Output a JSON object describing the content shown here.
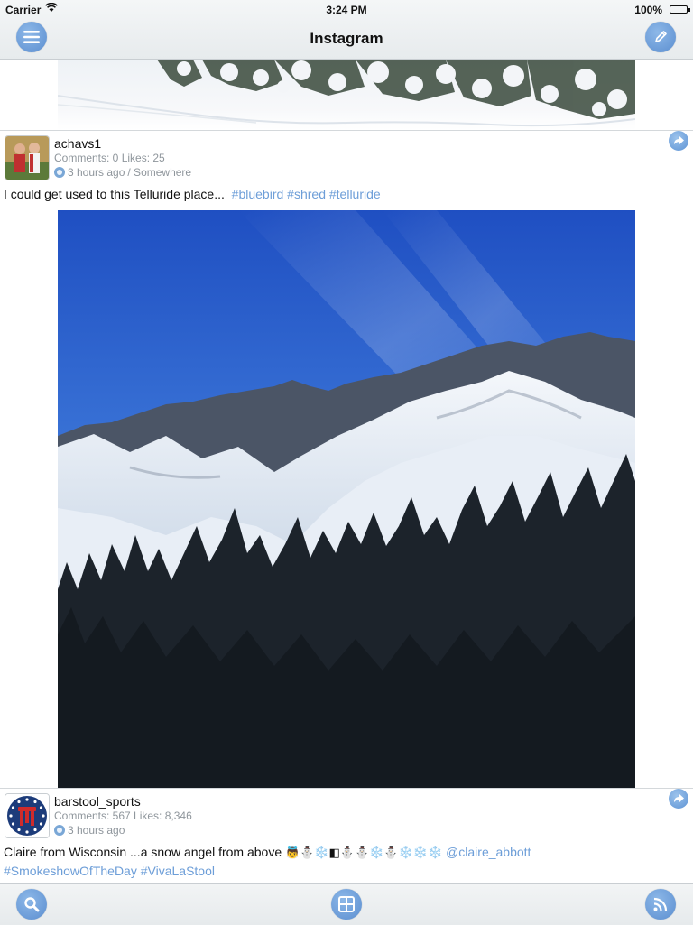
{
  "status_bar": {
    "carrier": "Carrier",
    "time": "3:24 PM",
    "battery": "100%"
  },
  "nav": {
    "title": "Instagram",
    "left_icon": "menu-icon",
    "right_icon": "compose-icon"
  },
  "posts": [
    {
      "username": "achavs1",
      "stats": "Comments: 0 Likes: 25",
      "time": "3 hours ago",
      "location": "/ Somewhere",
      "caption_text": "I could get used to this Telluride place...",
      "hashtags": [
        "#bluebird",
        "#shred",
        "#telluride"
      ]
    },
    {
      "username": "barstool_sports",
      "stats": "Comments: 567 Likes: 8,346",
      "time": "3 hours ago",
      "caption_text": "Claire from Wisconsin ...a snow angel from above",
      "caption_emoji": "👼⛄❄️◧⛄⛄❄️⛄❄️❄️❄️",
      "mention": "@claire_abbott",
      "caption_line2": [
        "#SmokeshowOfTheDay",
        "#VivaLaStool"
      ]
    }
  ],
  "tabbar": {
    "left_icon": "search-icon",
    "center_icon": "grid-icon",
    "right_icon": "rss-icon"
  },
  "colors": {
    "accent": "#5b8ed0",
    "link": "#6d9ed8",
    "meta_text": "#8f969c"
  }
}
